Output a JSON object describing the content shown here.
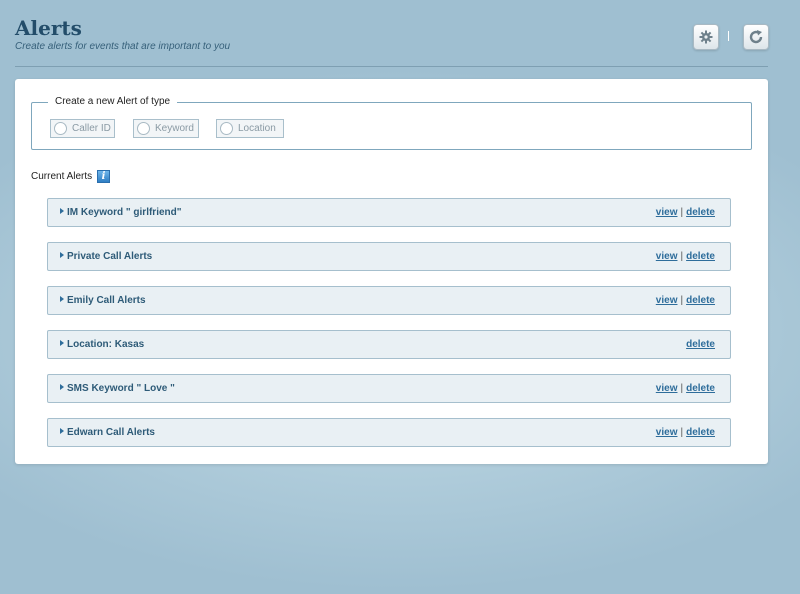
{
  "header": {
    "title": "Alerts",
    "subtitle": "Create alerts for events that are important to you",
    "settings_icon": "gear-icon",
    "refresh_icon": "refresh-icon"
  },
  "create": {
    "legend": "Create a new Alert of type",
    "types": [
      "Caller ID",
      "Keyword",
      "Location"
    ]
  },
  "current": {
    "label": "Current Alerts",
    "info_icon": "info-icon",
    "alerts": [
      {
        "title": "IM Keyword \" girlfriend\"",
        "view": "view",
        "delete": "delete"
      },
      {
        "title": "Private Call Alerts",
        "view": "view",
        "delete": "delete"
      },
      {
        "title": "Emily Call Alerts",
        "view": "view",
        "delete": "delete"
      },
      {
        "title": "Location: Kasas",
        "view": "",
        "delete": "delete"
      },
      {
        "title": "SMS Keyword \" Love \"",
        "view": "view",
        "delete": "delete"
      },
      {
        "title": "Edwarn Call Alerts",
        "view": "view",
        "delete": "delete"
      }
    ]
  },
  "colors": {
    "background": "#a9c6d6",
    "title": "#234d6a",
    "link": "#2e6d9b",
    "row_bg": "#e9f0f4"
  }
}
